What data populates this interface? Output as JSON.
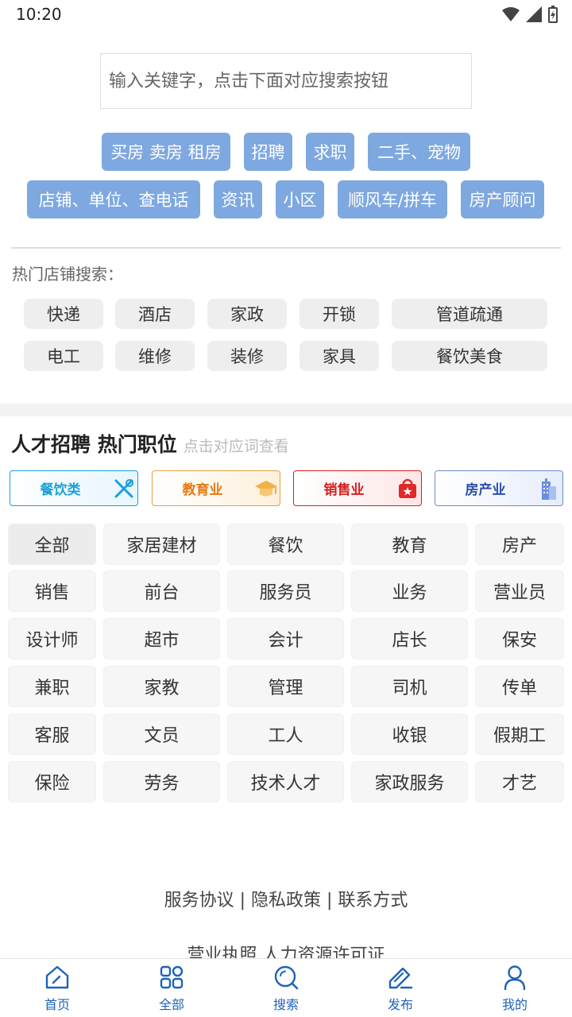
{
  "status": {
    "time": "10:20"
  },
  "search": {
    "placeholder": "输入关键字，点击下面对应搜索按钮"
  },
  "categories": [
    "买房 卖房 租房",
    "招聘",
    "求职",
    "二手、宠物",
    "店铺、单位、查电话",
    "资讯",
    "小区",
    "顺风车/拼车",
    "房产顾问"
  ],
  "hot_shops": {
    "title": "热门店铺搜索：",
    "tags": [
      "快递",
      "酒店",
      "家政",
      "开锁",
      "管道疏通",
      "电工",
      "维修",
      "装修",
      "家具",
      "餐饮美食"
    ]
  },
  "jobs": {
    "title": "人才招聘 热门职位",
    "hint": "点击对应词查看",
    "industries": [
      {
        "label": "餐饮类",
        "color": "#1aa0d8",
        "icon": "utensils-icon"
      },
      {
        "label": "教育业",
        "color": "#e57a12",
        "icon": "graduation-cap-icon"
      },
      {
        "label": "销售业",
        "color": "#d81e1e",
        "icon": "shopping-bag-icon"
      },
      {
        "label": "房产业",
        "color": "#2b4fa8",
        "icon": "building-icon"
      }
    ],
    "positions": [
      "全部",
      "家居建材",
      "餐饮",
      "教育",
      "房产",
      "销售",
      "前台",
      "服务员",
      "业务",
      "营业员",
      "设计师",
      "超市",
      "会计",
      "店长",
      "保安",
      "兼职",
      "家教",
      "管理",
      "司机",
      "传单",
      "客服",
      "文员",
      "工人",
      "收银",
      "假期工",
      "保险",
      "劳务",
      "技术人才",
      "家政服务",
      "才艺"
    ]
  },
  "footer": {
    "links": "服务协议 | 隐私政策 | 联系方式",
    "links2": "营业执照 人力资源许可证"
  },
  "nav": [
    {
      "label": "首页",
      "icon": "home-icon"
    },
    {
      "label": "全部",
      "icon": "grid-icon"
    },
    {
      "label": "搜索",
      "icon": "search-icon"
    },
    {
      "label": "发布",
      "icon": "edit-icon"
    },
    {
      "label": "我的",
      "icon": "user-icon"
    }
  ],
  "colors": {
    "accent": "#1e63b8",
    "category_button": "#7ea8e0"
  }
}
